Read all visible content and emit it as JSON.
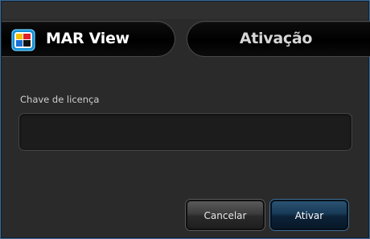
{
  "header": {
    "app_title": "MAR View",
    "app_logo": "mar-view-logo",
    "dialog_title": "Ativação"
  },
  "form": {
    "license_key_label": "Chave de licença",
    "license_key_value": "",
    "license_key_placeholder": ""
  },
  "buttons": {
    "cancel_label": "Cancelar",
    "activate_label": "Ativar"
  },
  "colors": {
    "background": "#2a2a2a",
    "pill": "#000000",
    "accent": "#173a57",
    "window_border": "#3c6a96"
  }
}
